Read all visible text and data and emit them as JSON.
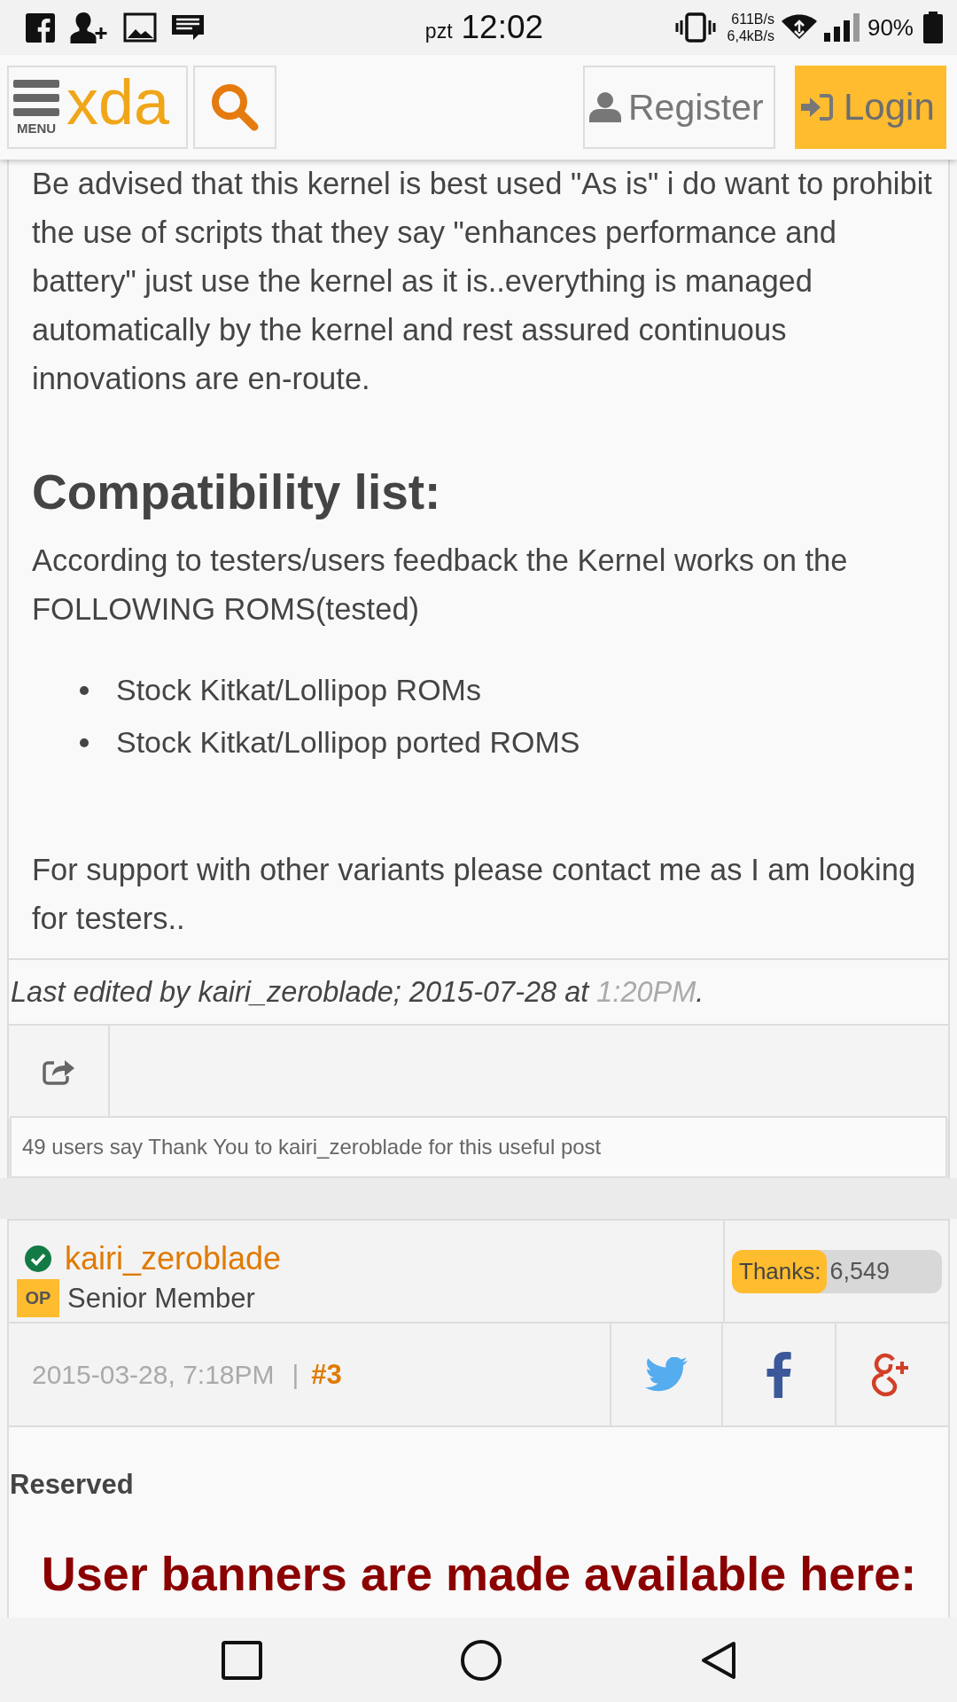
{
  "status_bar": {
    "carrier": "pzt",
    "time": "12:02",
    "upload_speed": "611B/s",
    "download_speed": "6,4kB/s",
    "battery": "90%"
  },
  "header": {
    "menu_label": "MENU",
    "logo": "xda",
    "register_button": "Register",
    "login_button": "Login"
  },
  "post": {
    "body": [
      {
        "kind": "paragraph",
        "text": "Be advised that this kernel is best used \"As is\" i do want to prohibit the use of scripts that they say \"enhances performance and battery\" just use the kernel as it is..everything is managed automatically by the kernel and rest assured continuous innovations are en-route."
      },
      {
        "kind": "heading",
        "text": "Compatibility list:"
      },
      {
        "kind": "paragraph",
        "text": "According to testers/users feedback the Kernel works on the FOLLOWING ROMS(tested)"
      },
      {
        "kind": "list",
        "items": [
          "Stock Kitkat/Lollipop ROMs",
          "Stock Kitkat/Lollipop ported ROMS"
        ]
      },
      {
        "kind": "paragraph",
        "text": "For support with other variants please contact me as I am looking for testers.."
      }
    ],
    "last_edited": {
      "text": "Last edited by kairi_zeroblade; 2015-07-28 at",
      "time": "1:20PM",
      "end": "."
    },
    "thanks_note": "49 users say Thank You to kairi_zeroblade for this useful post"
  },
  "next_post": {
    "username": "kairi_zeroblade",
    "badge": "OP",
    "member_title": "Senior Member",
    "thanks_label": "Thanks:",
    "thanks_count": "6,549",
    "date": "2015-03-28, 7:18PM",
    "separator": "|",
    "post_number": "#3",
    "body": [
      {
        "kind": "label",
        "text": "Reserved"
      },
      {
        "kind": "banner",
        "text": "User banners are made available here:"
      }
    ]
  }
}
